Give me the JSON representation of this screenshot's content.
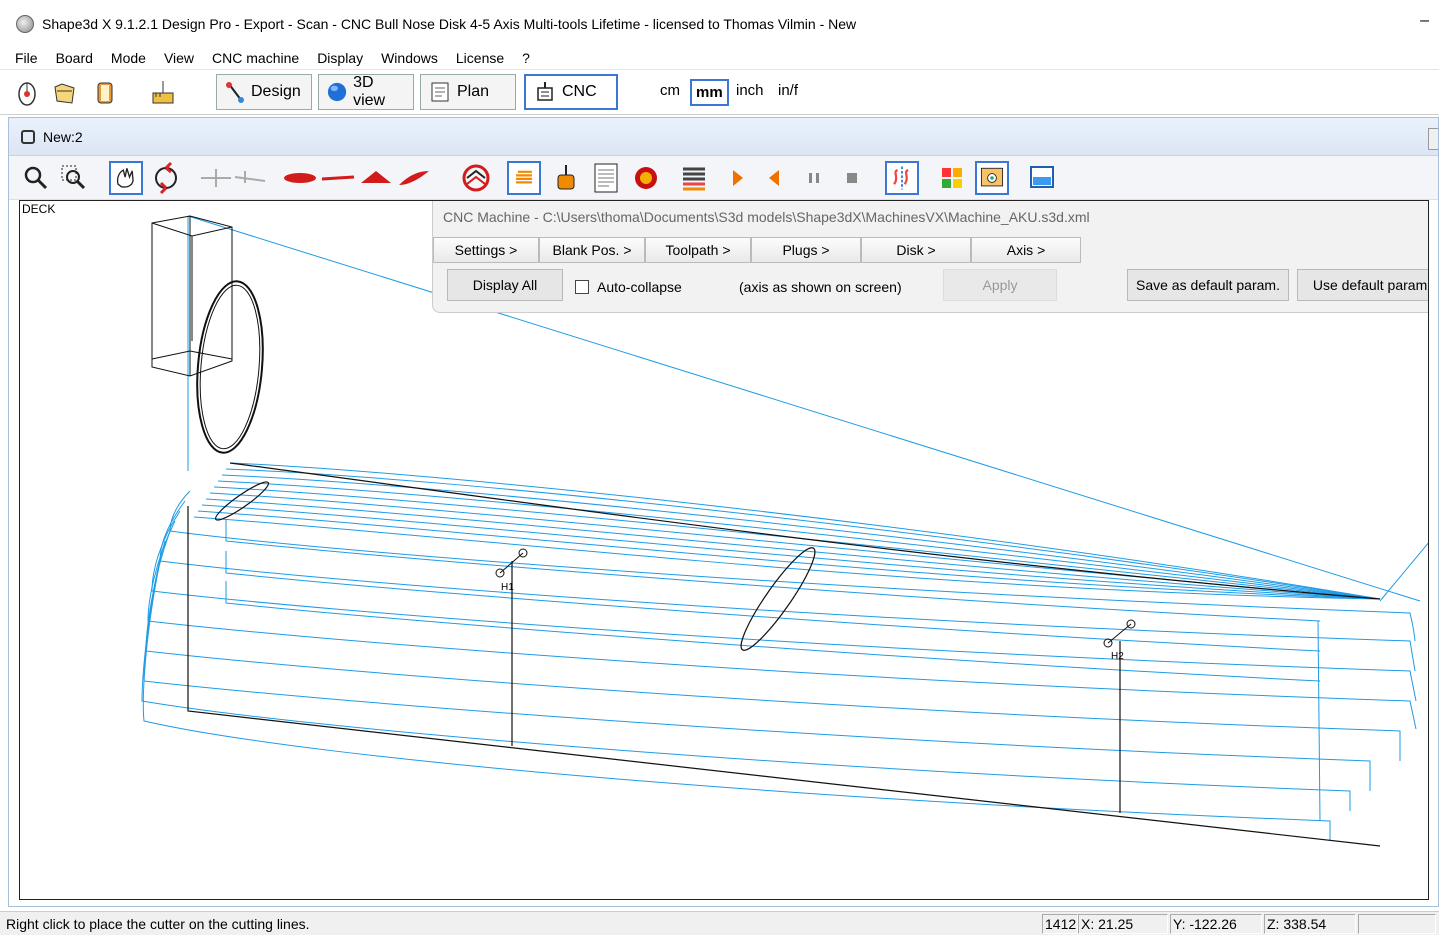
{
  "window": {
    "title": "Shape3d X 9.1.2.1 Design Pro - Export - Scan - CNC Bull Nose Disk 4-5 Axis Multi-tools Lifetime - licensed to Thomas Vilmin - New",
    "minimize": "–"
  },
  "menu": [
    "File",
    "Board",
    "Mode",
    "View",
    "CNC machine",
    "Display",
    "Windows",
    "License",
    "?"
  ],
  "modes": {
    "design": "Design",
    "view3d": "3D view",
    "plan": "Plan",
    "cnc": "CNC"
  },
  "units": {
    "cm": "cm",
    "mm": "mm",
    "inch": "inch",
    "inf": "in/f",
    "selected": "mm"
  },
  "document": {
    "title": "New:2"
  },
  "viewport": {
    "label": "DECK",
    "marker1": "H1",
    "marker2": "H2"
  },
  "cnc_panel": {
    "path": "CNC Machine - C:\\Users\\thoma\\Documents\\S3d models\\Shape3dX\\MachinesVX\\Machine_AKU.s3d.xml",
    "tabs": [
      "Settings >",
      "Blank Pos. >",
      "Toolpath >",
      "Plugs >",
      "Disk >",
      "Axis >"
    ],
    "display_all": "Display All",
    "auto_collapse": "Auto-collapse",
    "axis_note": "(axis as shown on screen)",
    "apply": "Apply",
    "save_default": "Save as default param.",
    "use_default": "Use default param."
  },
  "status": {
    "message": "Right click to place the cutter on the cutting lines.",
    "count": "1412",
    "x": "X: 21.25",
    "y": "Y: -122.26",
    "z": "Z: 338.54"
  },
  "colors": {
    "accent": "#3b78d6",
    "toolpath": "#1e9be6",
    "model": "#111111"
  }
}
